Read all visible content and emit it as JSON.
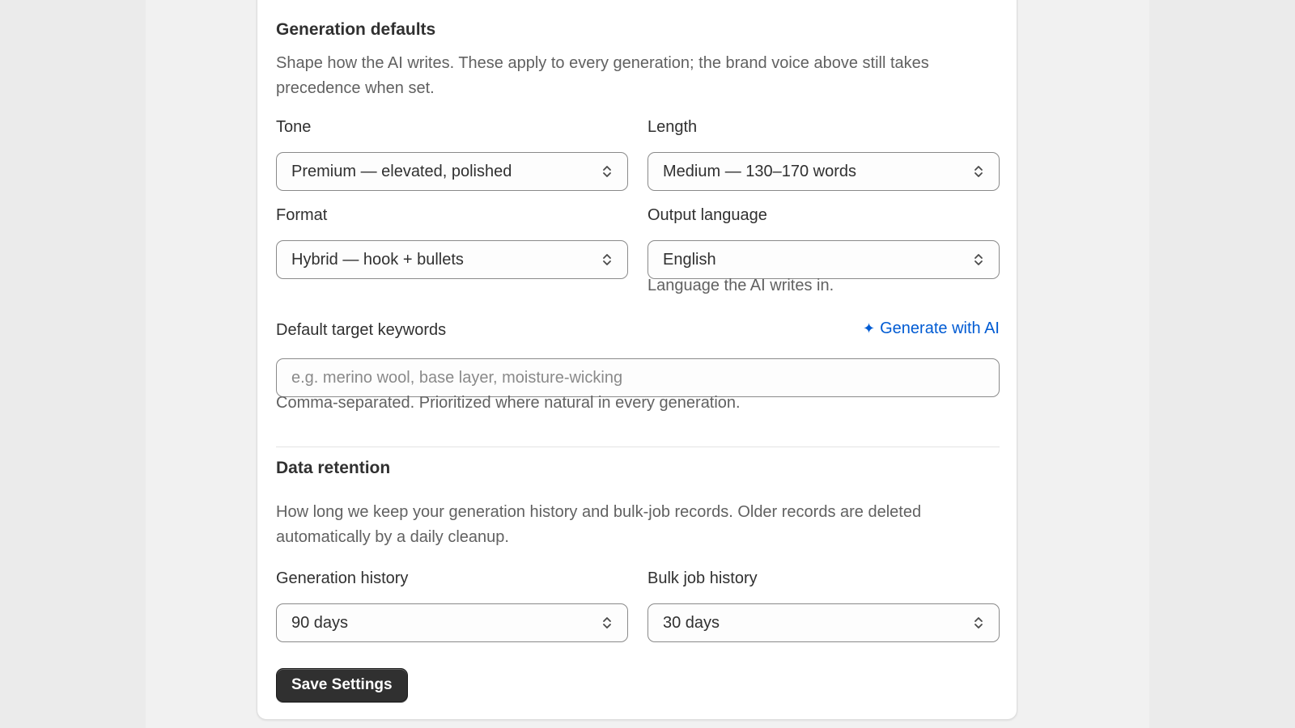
{
  "generation_defaults": {
    "title": "Generation defaults",
    "description": "Shape how the AI writes. These apply to every generation; the brand voice above still takes precedence when set.",
    "tone": {
      "label": "Tone",
      "value": "Premium — elevated, polished"
    },
    "length": {
      "label": "Length",
      "value": "Medium — 130–170 words"
    },
    "format": {
      "label": "Format",
      "value": "Hybrid — hook + bullets"
    },
    "output_language": {
      "label": "Output language",
      "value": "English",
      "help": "Language the AI writes in."
    },
    "keywords": {
      "label": "Default target keywords",
      "generate_link": "Generate with AI",
      "generate_icon": "sparkle-icon",
      "value": "",
      "placeholder": "e.g. merino wool, base layer, moisture-wicking",
      "help": "Comma-separated. Prioritized where natural in every generation."
    }
  },
  "data_retention": {
    "title": "Data retention",
    "description": "How long we keep your generation history and bulk-job records. Older records are deleted automatically by a daily cleanup.",
    "generation_history": {
      "label": "Generation history",
      "value": "90 days"
    },
    "bulk_job_history": {
      "label": "Bulk job history",
      "value": "30 days"
    }
  },
  "actions": {
    "save_label": "Save Settings"
  },
  "colors": {
    "accent_link": "#005bd3",
    "primary_button": "#303030",
    "text": "#303030",
    "muted_text": "#616161"
  }
}
